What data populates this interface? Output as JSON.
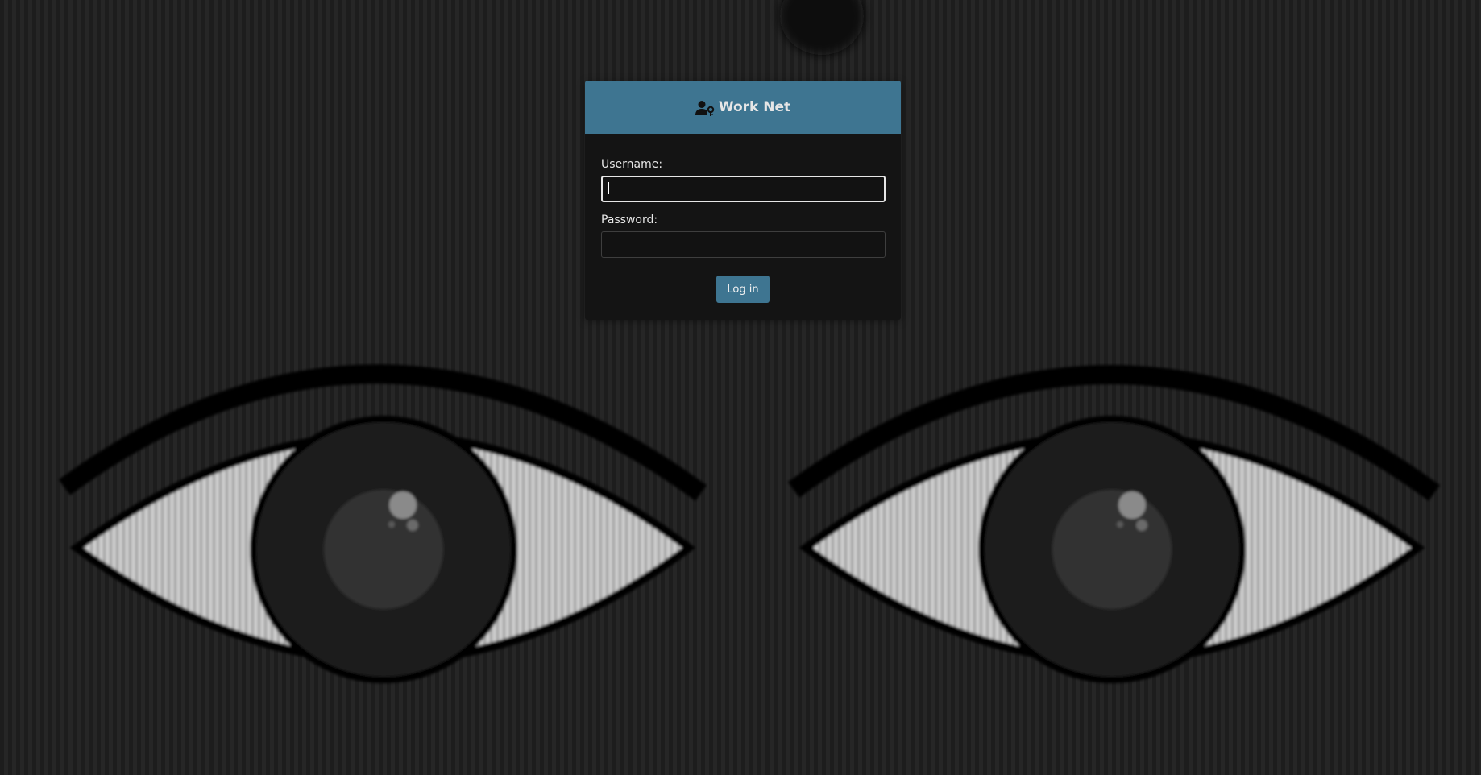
{
  "app": {
    "title": "Work Net",
    "header_icon": "user-lock-icon"
  },
  "form": {
    "username_label": "Username:",
    "username_value": "",
    "password_label": "Password:",
    "password_value": "",
    "submit_label": "Log in"
  },
  "colors": {
    "accent": "#3e7591",
    "panel": "#141414",
    "page_background": "#222222"
  },
  "background": {
    "illustration": "pair-of-eyes"
  }
}
